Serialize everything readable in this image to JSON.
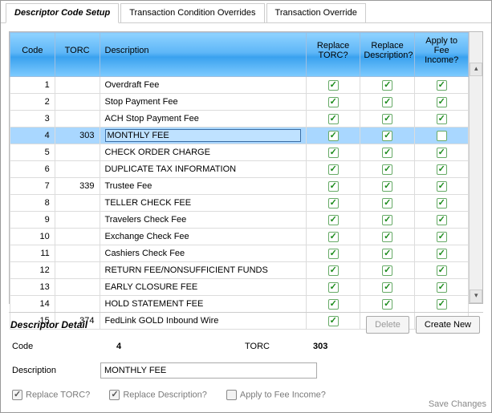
{
  "tabs": {
    "active": "Descriptor Code Setup",
    "t1": "Transaction Condition Overrides",
    "t2": "Transaction Override"
  },
  "headers": {
    "code": "Code",
    "torc": "TORC",
    "desc": "Description",
    "replace_torc": "Replace TORC?",
    "replace_desc": "Replace Description?",
    "apply_fee": "Apply to Fee Income?"
  },
  "rows": [
    {
      "code": "1",
      "torc": "",
      "desc": "Overdraft Fee",
      "rt": true,
      "rd": true,
      "af": true,
      "sel": false
    },
    {
      "code": "2",
      "torc": "",
      "desc": "Stop Payment Fee",
      "rt": true,
      "rd": true,
      "af": true,
      "sel": false
    },
    {
      "code": "3",
      "torc": "",
      "desc": "ACH Stop Payment Fee",
      "rt": true,
      "rd": true,
      "af": true,
      "sel": false
    },
    {
      "code": "4",
      "torc": "303",
      "desc": "MONTHLY FEE",
      "rt": true,
      "rd": true,
      "af": false,
      "sel": true
    },
    {
      "code": "5",
      "torc": "",
      "desc": "CHECK ORDER CHARGE",
      "rt": true,
      "rd": true,
      "af": true,
      "sel": false
    },
    {
      "code": "6",
      "torc": "",
      "desc": "DUPLICATE TAX INFORMATION",
      "rt": true,
      "rd": true,
      "af": true,
      "sel": false
    },
    {
      "code": "7",
      "torc": "339",
      "desc": "Trustee Fee",
      "rt": true,
      "rd": true,
      "af": true,
      "sel": false
    },
    {
      "code": "8",
      "torc": "",
      "desc": "TELLER CHECK FEE",
      "rt": true,
      "rd": true,
      "af": true,
      "sel": false
    },
    {
      "code": "9",
      "torc": "",
      "desc": "Travelers Check Fee",
      "rt": true,
      "rd": true,
      "af": true,
      "sel": false
    },
    {
      "code": "10",
      "torc": "",
      "desc": "Exchange Check Fee",
      "rt": true,
      "rd": true,
      "af": true,
      "sel": false
    },
    {
      "code": "11",
      "torc": "",
      "desc": "Cashiers Check Fee",
      "rt": true,
      "rd": true,
      "af": true,
      "sel": false
    },
    {
      "code": "12",
      "torc": "",
      "desc": "RETURN FEE/NONSUFFICIENT FUNDS",
      "rt": true,
      "rd": true,
      "af": true,
      "sel": false
    },
    {
      "code": "13",
      "torc": "",
      "desc": "EARLY CLOSURE FEE",
      "rt": true,
      "rd": true,
      "af": true,
      "sel": false
    },
    {
      "code": "14",
      "torc": "",
      "desc": "HOLD STATEMENT FEE",
      "rt": true,
      "rd": true,
      "af": true,
      "sel": false
    },
    {
      "code": "15",
      "torc": "374",
      "desc": "FedLink GOLD Inbound Wire",
      "rt": true,
      "rd": true,
      "af": true,
      "sel": false
    }
  ],
  "detail": {
    "title": "Descriptor Detail",
    "code_label": "Code",
    "code_value": "4",
    "torc_label": "TORC",
    "torc_value": "303",
    "desc_label": "Description",
    "desc_value": "MONTHLY FEE",
    "cb_rt": "Replace TORC?",
    "cb_rd": "Replace Description?",
    "cb_af": "Apply to Fee Income?",
    "rt_checked": true,
    "rd_checked": true,
    "af_checked": false
  },
  "buttons": {
    "delete": "Delete",
    "create": "Create New",
    "save": "Save Changes"
  }
}
